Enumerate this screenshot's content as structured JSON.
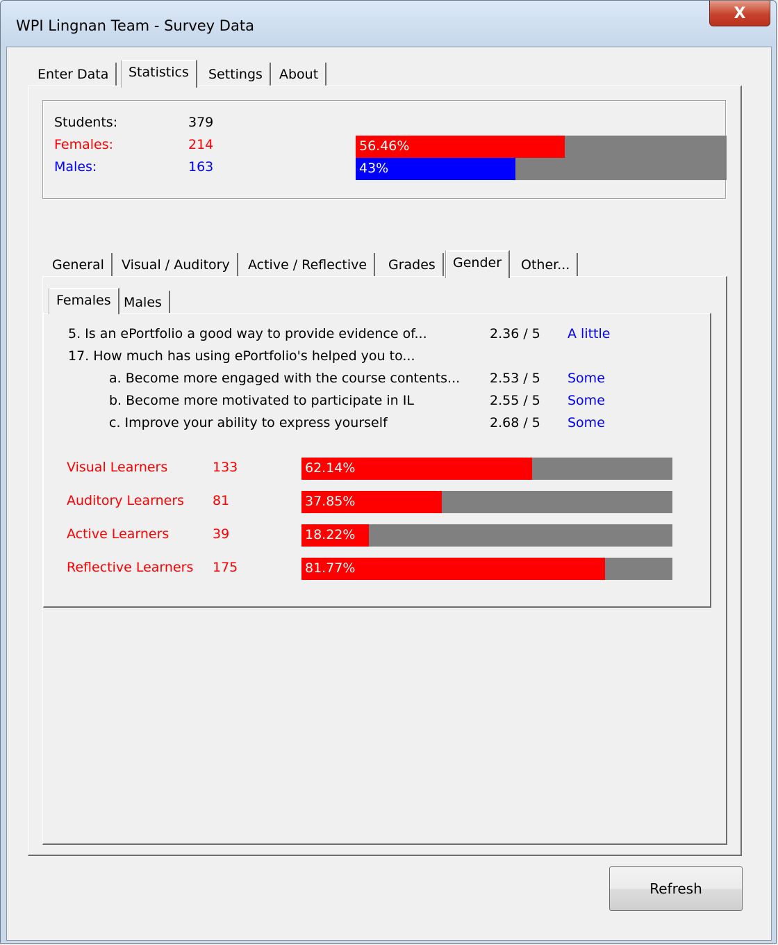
{
  "window": {
    "title": "WPI Lingnan Team - Survey Data",
    "close_glyph": "X"
  },
  "main_tabs": [
    "Enter Data",
    "Statistics",
    "Settings",
    "About"
  ],
  "summary": {
    "students_label": "Students:",
    "students_value": "379",
    "females_label": "Females:",
    "females_value": "214",
    "females_pct_text": "56.46%",
    "females_fraction": 0.5646,
    "males_label": "Males:",
    "males_value": "163",
    "males_pct_text": "43%",
    "males_fraction": 0.43
  },
  "sub_tabs": [
    "General",
    "Visual / Auditory",
    "Active / Reflective",
    "Grades",
    "Gender",
    "Other..."
  ],
  "gender_tabs": [
    "Females",
    "Males"
  ],
  "questions": [
    {
      "text": "5. Is an ePortfolio a good way to provide evidence of...",
      "score": "2.36 / 5",
      "rating": "A little"
    },
    {
      "text": "17. How much has using ePortfolio's helped you to...",
      "score": "",
      "rating": ""
    },
    {
      "text": "a. Become more engaged with the course contents...",
      "score": "2.53 / 5",
      "rating": "Some"
    },
    {
      "text": "b. Become more motivated to participate in IL",
      "score": "2.55 / 5",
      "rating": "Some"
    },
    {
      "text": "c. Improve your ability to express yourself",
      "score": "2.68 / 5",
      "rating": "Some"
    }
  ],
  "learners": [
    {
      "label": "Visual Learners",
      "count": "133",
      "pct_text": "62.14%",
      "fraction": 0.6214
    },
    {
      "label": "Auditory Learners",
      "count": "81",
      "pct_text": "37.85%",
      "fraction": 0.3785
    },
    {
      "label": "Active Learners",
      "count": "39",
      "pct_text": "18.22%",
      "fraction": 0.1822
    },
    {
      "label": "Reflective Learners",
      "count": "175",
      "pct_text": "81.77%",
      "fraction": 0.8177
    }
  ],
  "refresh_label": "Refresh",
  "colors": {
    "female": "#ff0000",
    "male": "#0000ff",
    "bar_track": "#808080"
  }
}
